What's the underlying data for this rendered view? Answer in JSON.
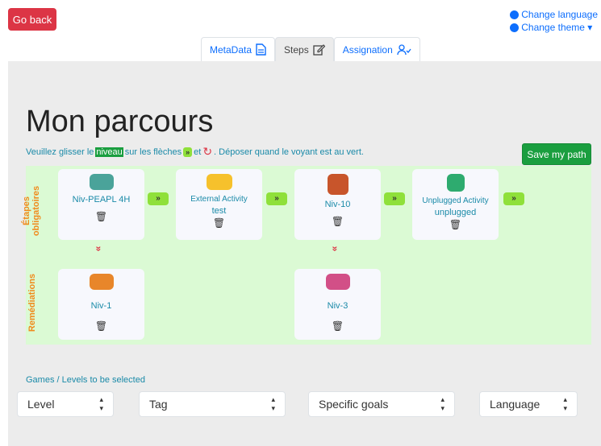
{
  "header": {
    "go_back": "Go back",
    "change_language": "Change language",
    "change_theme": "Change theme ▾"
  },
  "tabs": [
    {
      "label": "MetaData",
      "icon": "document-icon"
    },
    {
      "label": "Steps",
      "icon": "edit-icon"
    },
    {
      "label": "Assignation",
      "icon": "user-check-icon"
    }
  ],
  "main": {
    "title": "Mon parcours",
    "hint_pre": "Veuillez glisser le ",
    "hint_highlight": "niveau",
    "hint_mid": " sur les flèches ",
    "hint_arrow": "»",
    "hint_et": " et ",
    "hint_post": ". Déposer quand le voyant est au vert.",
    "save": "Save my path"
  },
  "rows": {
    "mandatory": "Étapes\nobligatoires",
    "remediation": "Remédiations"
  },
  "cards": [
    {
      "name": "Niv-PEAPL 4H",
      "sub": "",
      "thumb_color": "#4aa39a"
    },
    {
      "name": "External Activity",
      "sub": "test",
      "thumb_color": "#f6c12c"
    },
    {
      "name": "Niv-10",
      "sub": "",
      "thumb_color": "#c8552b"
    },
    {
      "name": "Unplugged Activity",
      "sub": "unplugged",
      "thumb_color": "#2eab6f"
    },
    {
      "name": "Niv-1",
      "sub": "",
      "thumb_color": "#e8862a"
    },
    {
      "name": "Niv-3",
      "sub": "",
      "thumb_color": "#d24f87"
    }
  ],
  "arrows": {
    "right": "»",
    "down": "»"
  },
  "trash": "🗑",
  "filters": {
    "label": "Games / Levels to be selected",
    "selects": [
      "Level",
      "Tag",
      "Specific goals",
      "Language"
    ]
  }
}
